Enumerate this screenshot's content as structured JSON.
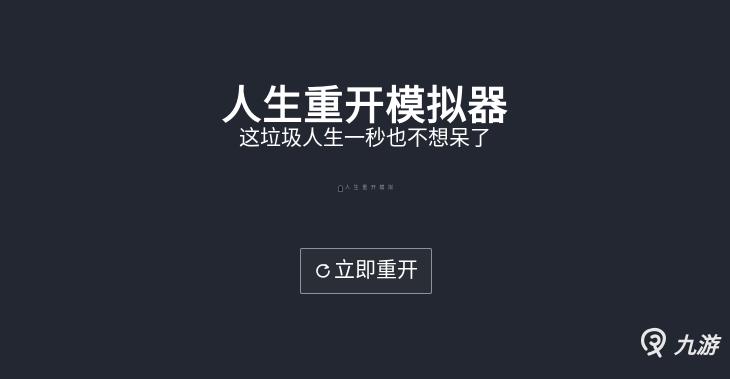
{
  "header": {
    "title": "人生重开模拟器",
    "subtitle": "这垃圾人生一秒也不想呆了"
  },
  "decorative_strip": {
    "text": "人 生 重 开 模 拟"
  },
  "actions": {
    "restart_label": "立即重开",
    "restart_icon": "refresh-icon"
  },
  "watermark": {
    "text": "九游",
    "icon": "nine-game-logo-icon"
  },
  "colors": {
    "background": "#232731",
    "text": "#ffffff",
    "button_border": "#8d9199"
  }
}
